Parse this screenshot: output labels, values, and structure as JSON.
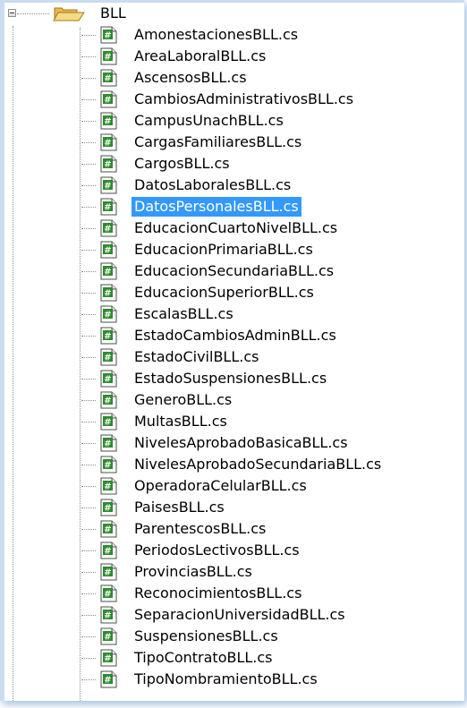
{
  "tree": {
    "folder": {
      "label": "BLL",
      "icon": "folder-open-icon",
      "expanded": true
    },
    "file_icon": "csharp-file-icon",
    "selected_index": 8,
    "items": [
      {
        "label": "AmonestacionesBLL.cs"
      },
      {
        "label": "AreaLaboralBLL.cs"
      },
      {
        "label": "AscensosBLL.cs"
      },
      {
        "label": "CambiosAdministrativosBLL.cs"
      },
      {
        "label": "CampusUnachBLL.cs"
      },
      {
        "label": "CargasFamiliaresBLL.cs"
      },
      {
        "label": "CargosBLL.cs"
      },
      {
        "label": "DatosLaboralesBLL.cs"
      },
      {
        "label": "DatosPersonalesBLL.cs"
      },
      {
        "label": "EducacionCuartoNivelBLL.cs"
      },
      {
        "label": "EducacionPrimariaBLL.cs"
      },
      {
        "label": "EducacionSecundariaBLL.cs"
      },
      {
        "label": "EducacionSuperiorBLL.cs"
      },
      {
        "label": "EscalasBLL.cs"
      },
      {
        "label": "EstadoCambiosAdminBLL.cs"
      },
      {
        "label": "EstadoCivilBLL.cs"
      },
      {
        "label": "EstadoSuspensionesBLL.cs"
      },
      {
        "label": "GeneroBLL.cs"
      },
      {
        "label": "MultasBLL.cs"
      },
      {
        "label": "NivelesAprobadoBasicaBLL.cs"
      },
      {
        "label": "NivelesAprobadoSecundariaBLL.cs"
      },
      {
        "label": "OperadoraCelularBLL.cs"
      },
      {
        "label": "PaisesBLL.cs"
      },
      {
        "label": "ParentescosBLL.cs"
      },
      {
        "label": "PeriodosLectivosBLL.cs"
      },
      {
        "label": "ProvinciasBLL.cs"
      },
      {
        "label": "ReconocimientosBLL.cs"
      },
      {
        "label": "SeparacionUniversidadBLL.cs"
      },
      {
        "label": "SuspensionesBLL.cs"
      },
      {
        "label": "TipoContratoBLL.cs"
      },
      {
        "label": "TipoNombramientoBLL.cs"
      }
    ]
  },
  "colors": {
    "selection": "#3399ff",
    "file_icon_green": "#2e8b2e",
    "folder": "#f2c85b"
  }
}
